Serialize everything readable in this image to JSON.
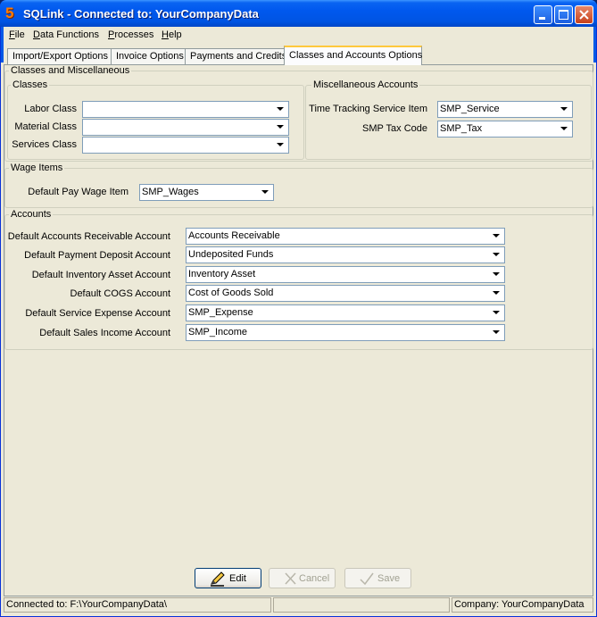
{
  "window": {
    "title": "SQLink - Connected to: YourCompanyData",
    "app_icon_glyph": "5"
  },
  "menu": [
    "File",
    "Data Functions",
    "Processes",
    "Help"
  ],
  "tabs": [
    {
      "label": "Import/Export Options",
      "active": false
    },
    {
      "label": "Invoice Options",
      "active": false
    },
    {
      "label": "Payments and Credits",
      "active": false
    },
    {
      "label": "Classes and Accounts Options",
      "active": true
    }
  ],
  "classes_misc": {
    "title": "Classes and Miscellaneous",
    "classes": {
      "title": "Classes",
      "labor_class_label": "Labor Class",
      "labor_class_value": "",
      "material_class_label": "Material Class",
      "material_class_value": "",
      "services_class_label": "Services Class",
      "services_class_value": ""
    },
    "misc_accounts": {
      "title": "Miscellaneous Accounts",
      "time_tracking_label": "Time Tracking Service Item",
      "time_tracking_value": "SMP_Service",
      "tax_code_label": "SMP Tax Code",
      "tax_code_value": "SMP_Tax"
    }
  },
  "wage_items": {
    "title": "Wage Items",
    "pay_wage_label": "Default Pay Wage Item",
    "pay_wage_value": "SMP_Wages"
  },
  "accounts": {
    "title": "Accounts",
    "rows": [
      {
        "label": "Default Accounts Receivable Account",
        "value": "Accounts Receivable"
      },
      {
        "label": "Default Payment Deposit Account",
        "value": "Undeposited Funds"
      },
      {
        "label": "Default Inventory Asset Account",
        "value": "Inventory Asset"
      },
      {
        "label": "Default COGS Account",
        "value": "Cost of Goods Sold"
      },
      {
        "label": "Default Service Expense Account",
        "value": "SMP_Expense"
      },
      {
        "label": "Default Sales Income Account",
        "value": "SMP_Income"
      }
    ]
  },
  "buttons": {
    "edit": "Edit",
    "cancel": "Cancel",
    "save": "Save"
  },
  "status": {
    "connected": "Connected to: F:\\YourCompanyData\\",
    "middle": "",
    "company": "Company: YourCompanyData"
  },
  "icons": {
    "edit": "pencil-icon",
    "cancel": "cancel-x-icon",
    "save": "checkmark-icon"
  }
}
